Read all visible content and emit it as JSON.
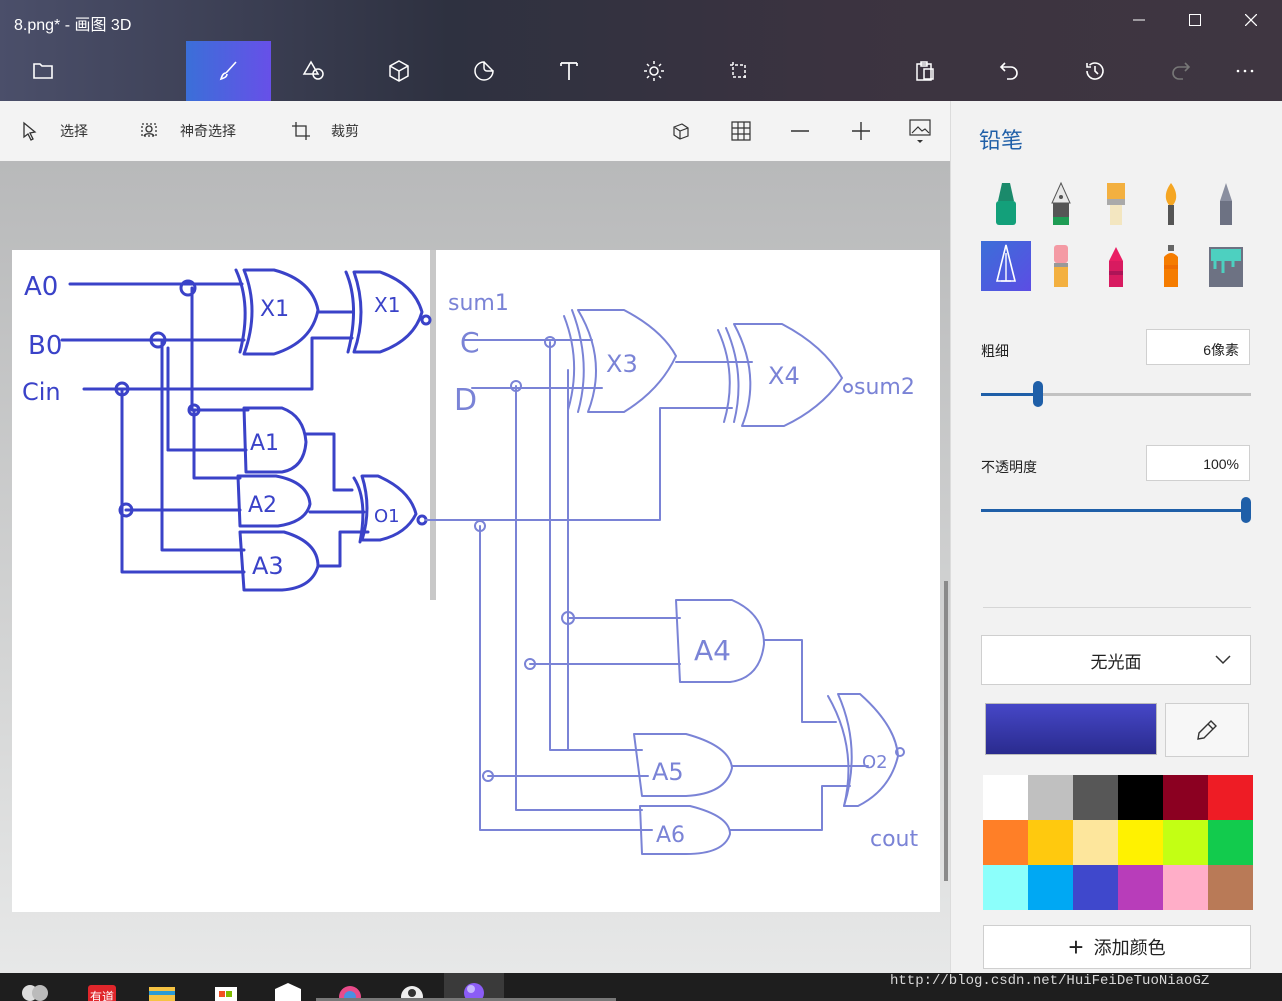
{
  "window": {
    "title": "8.png* - 画图 3D",
    "minimize": "—",
    "maximize": "☐",
    "close": "✕"
  },
  "toolbar": {
    "tools": [
      "menu-icon",
      "brushes-icon",
      "2d-shapes-icon",
      "3d-shapes-icon",
      "stickers-icon",
      "text-icon",
      "effects-icon",
      "canvas-icon"
    ],
    "active_tool": "brushes-icon",
    "right": [
      "paste-icon",
      "undo-icon",
      "history-icon",
      "redo-icon",
      "more-icon"
    ]
  },
  "subbar": {
    "select": "选择",
    "magic_select": "神奇选择",
    "crop": "裁剪"
  },
  "panel": {
    "title": "铅笔",
    "brushes": [
      "marker",
      "calligraphy-pen",
      "oil-brush",
      "watercolor",
      "pencil",
      "pixel-pen",
      "eraser",
      "crayon",
      "spray-can",
      "fill"
    ],
    "active_brush": "pixel-pen",
    "thickness": {
      "label": "粗细",
      "value": "6像素",
      "fraction": 0.2
    },
    "opacity": {
      "label": "不透明度",
      "value": "100%",
      "fraction": 1.0
    },
    "finish": "无光面",
    "current_color": "#4647c7",
    "palette": [
      "#ffffff",
      "#c0c0c0",
      "#575757",
      "#000000",
      "#8b0021",
      "#ee1c25",
      "#ff7f27",
      "#ffc90e",
      "#fde69c",
      "#fff200",
      "#c3ff14",
      "#12cb4d",
      "#8cfffb",
      "#00a8f3",
      "#3f48cc",
      "#b83dba",
      "#ffaec8",
      "#b97a57"
    ],
    "add_color": "添加颜色"
  },
  "watermark": "http://blog.csdn.net/HuiFeiDeTuoNiaoGZ",
  "drawing": {
    "labels": [
      "A0",
      "B0",
      "Cin",
      "X1",
      "X1",
      "A1",
      "A2",
      "A3",
      "O1",
      "sum1",
      "C",
      "D",
      "X3",
      "X4",
      "sum2",
      "A4",
      "A5",
      "A6",
      "O2",
      "cout"
    ]
  }
}
